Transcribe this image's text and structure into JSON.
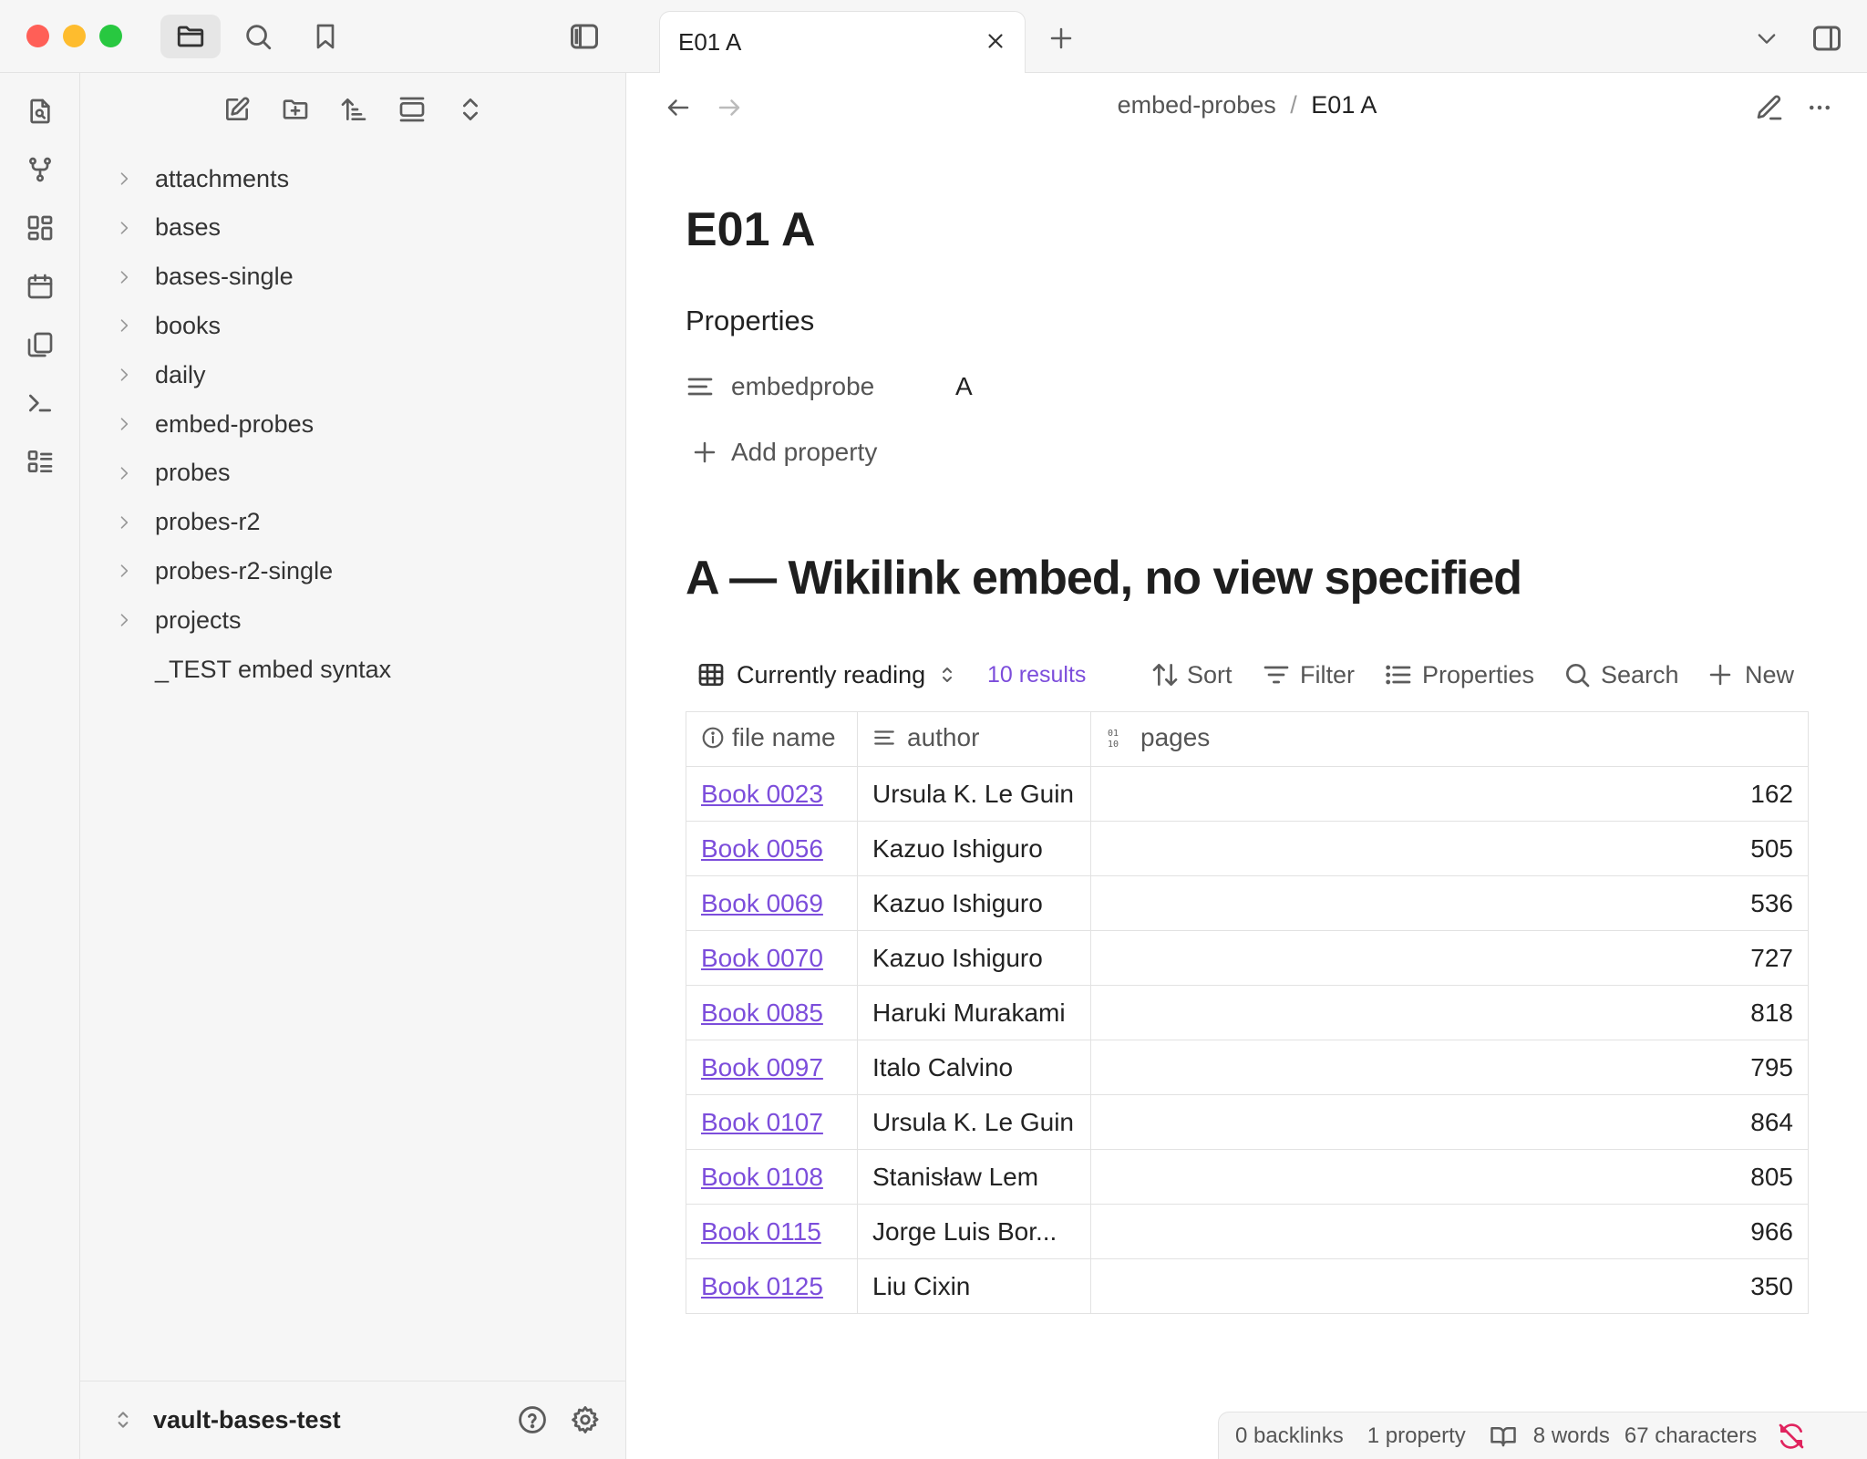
{
  "window": {
    "traffic_colors": [
      "#ff5f57",
      "#febc2e",
      "#28c840"
    ]
  },
  "sidebar": {
    "tree": [
      {
        "label": "attachments",
        "type": "folder"
      },
      {
        "label": "bases",
        "type": "folder"
      },
      {
        "label": "bases-single",
        "type": "folder"
      },
      {
        "label": "books",
        "type": "folder"
      },
      {
        "label": "daily",
        "type": "folder"
      },
      {
        "label": "embed-probes",
        "type": "folder"
      },
      {
        "label": "probes",
        "type": "folder"
      },
      {
        "label": "probes-r2",
        "type": "folder"
      },
      {
        "label": "probes-r2-single",
        "type": "folder"
      },
      {
        "label": "projects",
        "type": "folder"
      },
      {
        "label": "_TEST embed syntax",
        "type": "file"
      }
    ],
    "vault_name": "vault-bases-test"
  },
  "tab": {
    "title": "E01 A"
  },
  "breadcrumb": {
    "folder": "embed-probes",
    "separator": "/",
    "file": "E01 A"
  },
  "note": {
    "title": "E01 A",
    "properties_heading": "Properties",
    "property_name": "embedprobe",
    "property_value": "A",
    "add_property_label": "Add property",
    "section_heading": "A — Wikilink embed, no view specified"
  },
  "base": {
    "view_name": "Currently reading",
    "results": "10 results",
    "toolbar": {
      "sort": "Sort",
      "filter": "Filter",
      "properties": "Properties",
      "search": "Search",
      "new": "New"
    },
    "columns": [
      "file name",
      "author",
      "pages"
    ],
    "rows": [
      [
        "Book 0023",
        "Ursula K. Le Guin",
        "162"
      ],
      [
        "Book 0056",
        "Kazuo Ishiguro",
        "505"
      ],
      [
        "Book 0069",
        "Kazuo Ishiguro",
        "536"
      ],
      [
        "Book 0070",
        "Kazuo Ishiguro",
        "727"
      ],
      [
        "Book 0085",
        "Haruki Murakami",
        "818"
      ],
      [
        "Book 0097",
        "Italo Calvino",
        "795"
      ],
      [
        "Book 0107",
        "Ursula K. Le Guin",
        "864"
      ],
      [
        "Book 0108",
        "Stanisław Lem",
        "805"
      ],
      [
        "Book 0115",
        "Jorge Luis Bor...",
        "966"
      ],
      [
        "Book 0125",
        "Liu Cixin",
        "350"
      ]
    ]
  },
  "status": {
    "backlinks": "0 backlinks",
    "properties": "1 property",
    "words": "8 words",
    "characters": "67 characters"
  },
  "colors": {
    "accent": "#7c4ddb",
    "sync_error": "#e0245e"
  }
}
